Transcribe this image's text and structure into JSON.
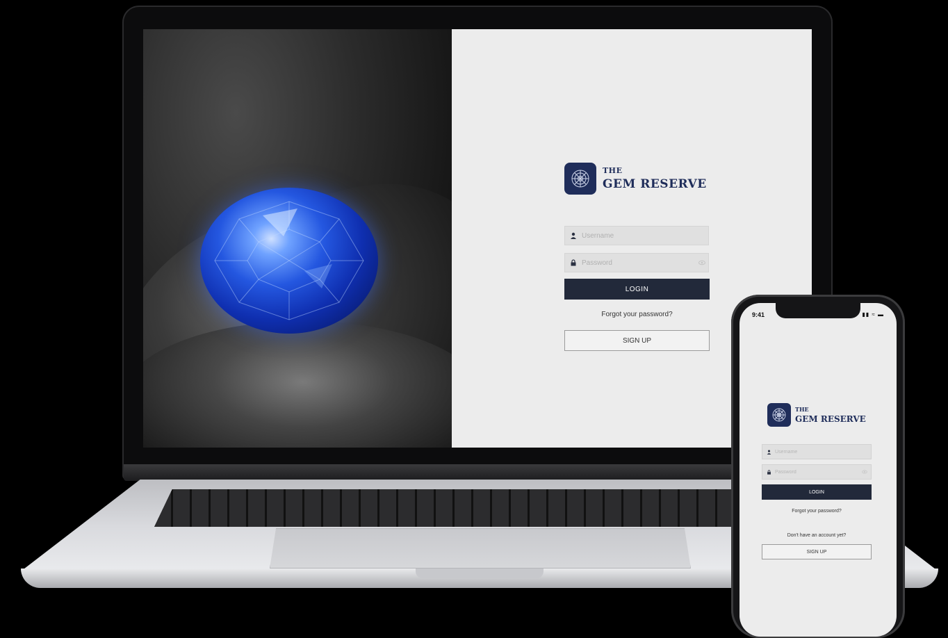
{
  "desktop": {
    "brand": {
      "the": "THE",
      "name": "GEM RESERVE"
    },
    "username_placeholder": "Username",
    "password_placeholder": "Password",
    "login_label": "LOGIN",
    "forgot_label": "Forgot your password?",
    "signup_label": "SIGN UP"
  },
  "mobile": {
    "status": {
      "time": "9:41"
    },
    "brand": {
      "the": "THE",
      "name": "GEM RESERVE"
    },
    "username_placeholder": "Username",
    "password_placeholder": "Password",
    "login_label": "LOGIN",
    "forgot_label": "Forgot your password?",
    "no_account_label": "Don't have an account yet?",
    "signup_label": "SIGN UP"
  },
  "colors": {
    "brand_navy": "#1f2d5a",
    "button_dark": "#22293a",
    "gem_blue": "#2457e0"
  },
  "icons": [
    "user-icon",
    "lock-icon",
    "eye-icon",
    "logo-emblem-icon",
    "signal-icon",
    "wifi-icon",
    "battery-icon"
  ]
}
